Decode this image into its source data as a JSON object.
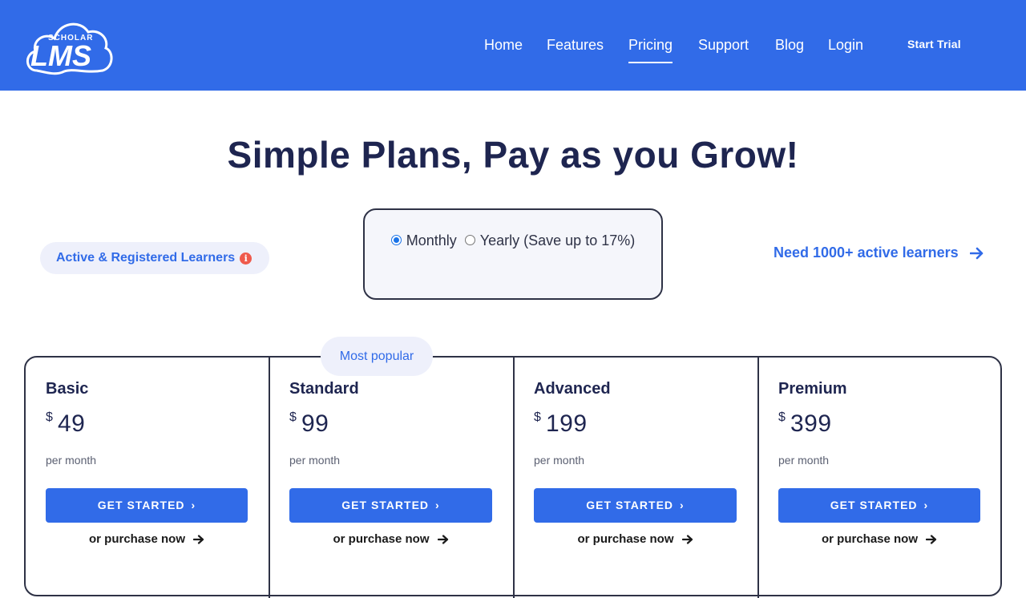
{
  "header": {
    "logo": {
      "top_text": "SCHOLAR",
      "main_text": "LMS"
    },
    "nav": [
      {
        "label": "Home",
        "active": false
      },
      {
        "label": "Features",
        "active": false
      },
      {
        "label": "Pricing",
        "active": true
      },
      {
        "label": "Support",
        "active": false
      },
      {
        "label": "Blog",
        "active": false
      },
      {
        "label": "Login",
        "active": false
      }
    ],
    "cta": "Start Trial"
  },
  "main": {
    "title": "Simple Plans, Pay as you Grow!",
    "learners_pill": "Active & Registered Learners",
    "billing": {
      "monthly_label": "Monthly",
      "yearly_label": "Yearly (Save up to 17%)",
      "selected": "monthly"
    },
    "need_link": "Need 1000+ active learners",
    "most_popular": "Most popular",
    "plans": [
      {
        "name": "Basic",
        "currency": "$",
        "price": "49",
        "period": "per month",
        "cta": "GET STARTED",
        "purchase": "or purchase now"
      },
      {
        "name": "Standard",
        "currency": "$",
        "price": "99",
        "period": "per month",
        "cta": "GET STARTED",
        "purchase": "or purchase now"
      },
      {
        "name": "Advanced",
        "currency": "$",
        "price": "199",
        "period": "per month",
        "cta": "GET STARTED",
        "purchase": "or purchase now"
      },
      {
        "name": "Premium",
        "currency": "$",
        "price": "399",
        "period": "per month",
        "cta": "GET STARTED",
        "purchase": "or purchase now"
      }
    ]
  },
  "colors": {
    "brand": "#316be8",
    "text_dark": "#1e2550",
    "pill_bg": "#eef0fb",
    "info_red": "#ef5a4c"
  },
  "icons": {
    "info": "info-icon",
    "arrow": "arrow-right-icon",
    "chevron": "chevron-right-icon"
  }
}
